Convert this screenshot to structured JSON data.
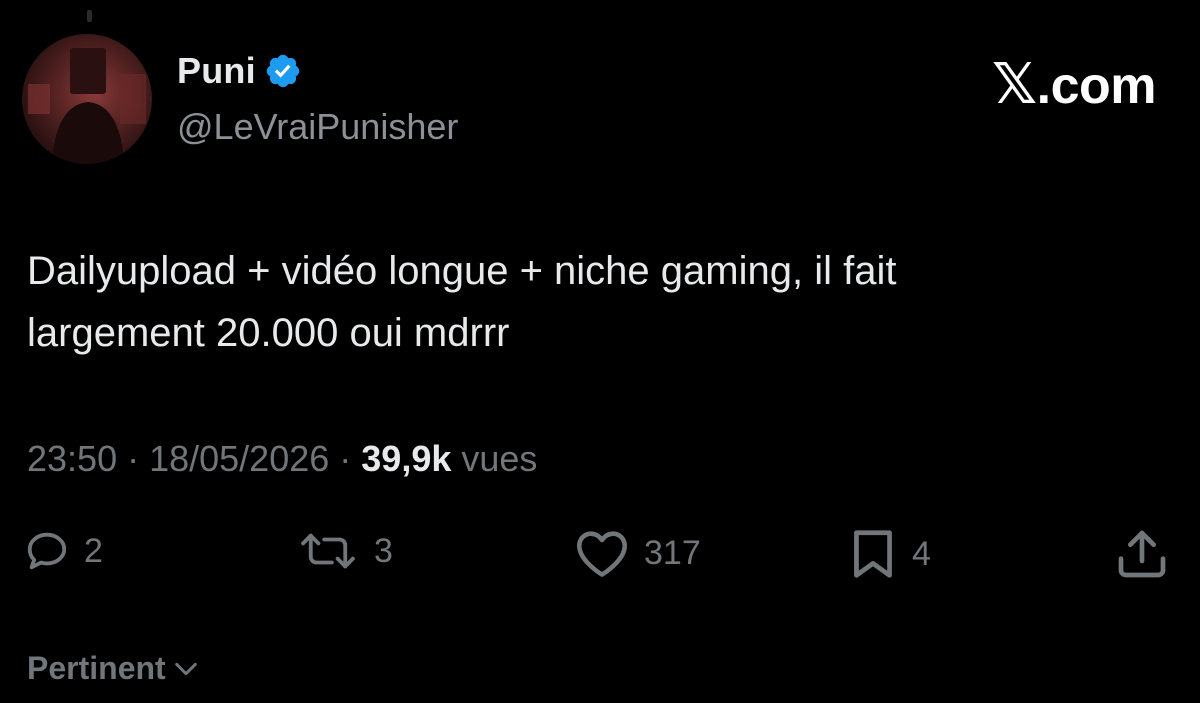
{
  "user": {
    "display_name": "Puni",
    "handle": "@LeVraiPunisher",
    "verified": true
  },
  "brand": {
    "label": "X.com",
    "x_glyph": "𝕏",
    "suffix": ".com"
  },
  "tweet": {
    "line1": "Dailyupload + vidéo longue + niche gaming, il fait",
    "line2": "largement 20.000 oui mdrrr"
  },
  "meta": {
    "time": "23:50",
    "separator": " · ",
    "date": "18/05/2026",
    "views_count": "39,9k",
    "views_label": " vues"
  },
  "actions": {
    "replies": "2",
    "reposts": "3",
    "likes": "317",
    "bookmarks": "4"
  },
  "sort": {
    "label": "Pertinent"
  },
  "colors": {
    "background": "#000000",
    "text": "#e7e9ea",
    "muted": "#71767b",
    "verified_blue": "#1d9bf0"
  },
  "icons": [
    "verified-badge-icon",
    "reply-icon",
    "repost-icon",
    "like-icon",
    "bookmark-icon",
    "share-icon",
    "chevron-down-icon"
  ]
}
